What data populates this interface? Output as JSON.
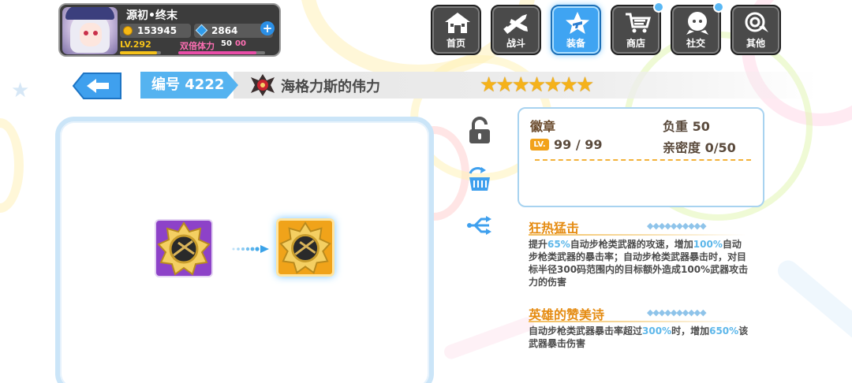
{
  "player": {
    "name": "源初•终末",
    "gold": "153945",
    "gems": "2864",
    "level": "LV.292",
    "level_progress": 0.9,
    "double_stamina_label": "双倍体力",
    "double_stamina_value": "50",
    "double_stamina_max": "00",
    "double_stamina_progress": 0.9
  },
  "nav": [
    {
      "label": "首页",
      "icon": "home-icon",
      "active": false
    },
    {
      "label": "战斗",
      "icon": "battle-icon",
      "active": false
    },
    {
      "label": "装备",
      "icon": "equipment-icon",
      "active": true
    },
    {
      "label": "商店",
      "icon": "shop-icon",
      "active": false,
      "notify": true
    },
    {
      "label": "社交",
      "icon": "social-icon",
      "active": false,
      "notify": true
    },
    {
      "label": "其他",
      "icon": "other-icon",
      "active": false
    }
  ],
  "item": {
    "number": "编号 4222",
    "name": "海格力斯的伟力",
    "stars": 7,
    "type": "徽章",
    "weight": "负重 50",
    "lv_tag": "LV.",
    "level": "99 / 99",
    "affinity": "亲密度 0/50"
  },
  "skills": [
    {
      "name": "狂热猛击",
      "desc_parts": [
        {
          "text": "提升",
          "hl": false
        },
        {
          "text": "65%",
          "hl": true
        },
        {
          "text": "自动步枪类武器的攻速，增加",
          "hl": false
        },
        {
          "text": "100%",
          "hl": true
        },
        {
          "text": "自动步枪类武器的暴击率；自动步枪类武器暴击时，对目标半径300码范围内的目标额外造成100%武器攻击力的伤害",
          "hl": false
        }
      ]
    },
    {
      "name": "英雄的赞美诗",
      "desc_parts": [
        {
          "text": "自动步枪类武器暴击率超过",
          "hl": false
        },
        {
          "text": "300%",
          "hl": true
        },
        {
          "text": "时，增加",
          "hl": false
        },
        {
          "text": "650%",
          "hl": true
        },
        {
          "text": "该武器暴击伤害",
          "hl": false
        }
      ]
    }
  ],
  "colors": {
    "accent_blue": "#55b3f0",
    "star_gold": "#f5b21a",
    "skill_orange": "#e58b11",
    "highlight": "#5db7ea"
  }
}
